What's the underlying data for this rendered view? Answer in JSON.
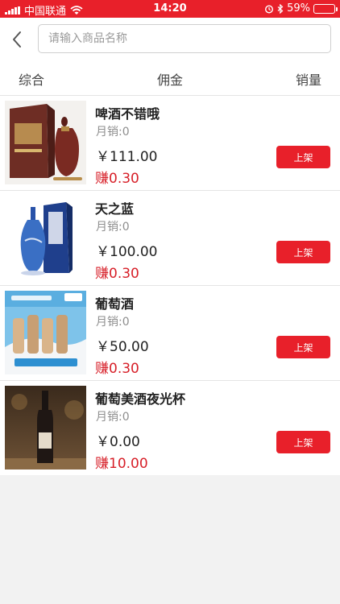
{
  "status_bar": {
    "carrier": "中国联通",
    "time": "14:20",
    "battery": "59%",
    "battery_level": 0.59,
    "icons": [
      "signal-icon",
      "wifi-icon",
      "alarm-icon",
      "bluetooth-icon",
      "battery-icon"
    ]
  },
  "header": {
    "back_icon": "chevron-left-icon",
    "search_placeholder": "请输入商品名称",
    "search_value": ""
  },
  "sort_tabs": [
    "综合",
    "佣金",
    "销量"
  ],
  "products": [
    {
      "name": "啤酒不错哦",
      "sales": "月销:0",
      "price": "￥111.00",
      "earn": "赚0.30",
      "button": "上架",
      "image": "baijiu-gift-box"
    },
    {
      "name": "天之蓝",
      "sales": "月销:0",
      "price": "￥100.00",
      "earn": "赚0.30",
      "button": "上架",
      "image": "blue-liquor-bottle"
    },
    {
      "name": "葡萄酒",
      "sales": "月销:0",
      "price": "￥50.00",
      "earn": "赚0.30",
      "button": "上架",
      "image": "juice-drink-promo"
    },
    {
      "name": "葡萄美酒夜光杯",
      "sales": "月销:0",
      "price": "￥0.00",
      "earn": "赚10.00",
      "button": "上架",
      "image": "wine-bottle"
    }
  ],
  "colors": {
    "accent": "#e8202a",
    "earn_text": "#d71f28",
    "background": "#f2f2f2"
  }
}
